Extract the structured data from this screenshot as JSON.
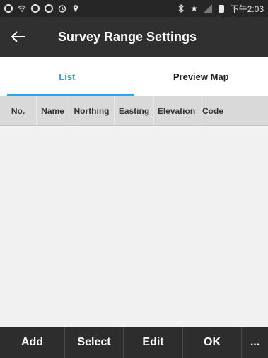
{
  "status_bar": {
    "time": "下午2:03",
    "icons": [
      "ring-icon",
      "wifi-icon",
      "ring-icon",
      "ring-icon",
      "alarm-icon",
      "location-pin-icon",
      "bluetooth-icon",
      "star-icon",
      "signal-icon",
      "battery-icon"
    ]
  },
  "app_bar": {
    "title": "Survey Range Settings"
  },
  "tabs": [
    {
      "label": "List",
      "active": true
    },
    {
      "label": "Preview Map",
      "active": false
    }
  ],
  "table": {
    "columns": [
      "No.",
      "Name",
      "Northing",
      "Easting",
      "Elevation",
      "Code"
    ],
    "rows": []
  },
  "bottom_bar": {
    "buttons": [
      "Add",
      "Select",
      "Edit",
      "OK",
      "..."
    ]
  },
  "colors": {
    "accent": "#2aa6e8",
    "app_bar": "#303030",
    "status_bar": "#262626",
    "bottom_bar": "#2d2d2d",
    "header_bg": "#d9d9d9"
  }
}
